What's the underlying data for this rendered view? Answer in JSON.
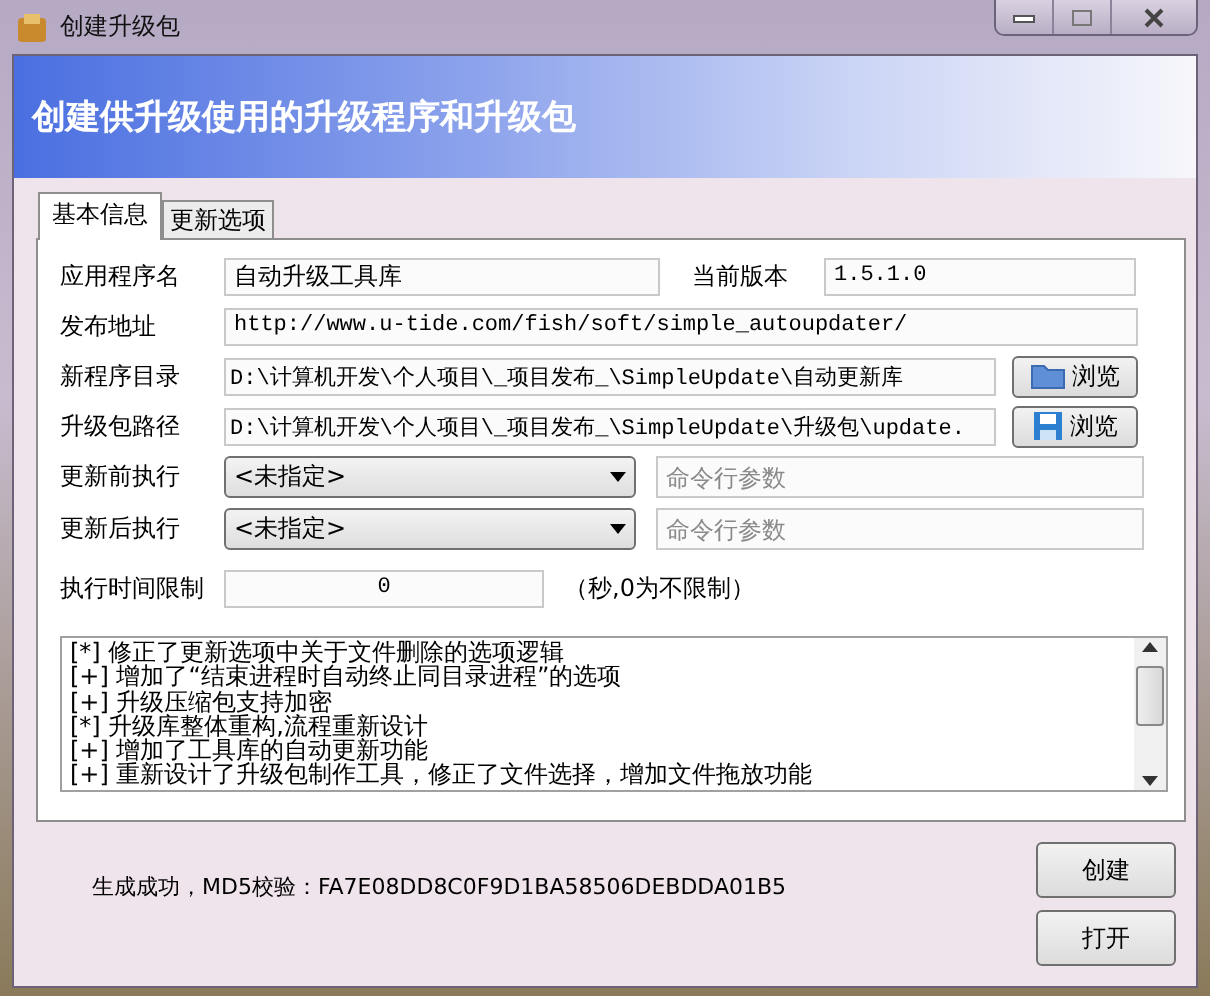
{
  "window": {
    "title": "创建升级包"
  },
  "header": {
    "title": "创建供升级使用的升级程序和升级包"
  },
  "tabs": [
    {
      "label": "基本信息",
      "selected": true
    },
    {
      "label": "更新选项",
      "selected": false
    }
  ],
  "form": {
    "app_name": {
      "label": "应用程序名",
      "value": "自动升级工具库"
    },
    "version": {
      "label": "当前版本",
      "value": "1.5.1.0"
    },
    "publish_url": {
      "label": "发布地址",
      "value": "http://www.u-tide.com/fish/soft/simple_autoupdater/"
    },
    "paths": [
      {
        "label": "新程序目录",
        "value": "D:\\计算机开发\\个人项目\\_项目发布_\\SimpleUpdate\\自动更新库",
        "button": "浏览",
        "kind": "folder"
      },
      {
        "label": "升级包路径",
        "value": "D:\\计算机开发\\个人项目\\_项目发布_\\SimpleUpdate\\升级包\\update.",
        "button": "浏览",
        "kind": "disk"
      }
    ],
    "exec": [
      {
        "label": "更新前执行",
        "selection": "<未指定>",
        "placeholder": "命令行参数"
      },
      {
        "label": "更新后执行",
        "selection": "<未指定>",
        "placeholder": "命令行参数"
      }
    ],
    "time_limit": {
      "label": "执行时间限制",
      "value": "0",
      "hint": "（秒,0为不限制）"
    }
  },
  "log": {
    "lines": [
      "[*] 修正了更新选项中关于文件删除的选项逻辑",
      "[+] 增加了“结束进程时自动终止同目录进程”的选项",
      "[+] 升级压缩包支持加密",
      "[*] 升级库整体重构,流程重新设计",
      "[+] 增加了工具库的自动更新功能",
      "[+] 重新设计了升级包制作工具，修正了文件选择，增加文件拖放功能"
    ]
  },
  "status": "生成成功，MD5校验：FA7E08DD8C0F9D1BA58506DEBDDA01B5",
  "buttons": [
    "创建",
    "打开"
  ]
}
